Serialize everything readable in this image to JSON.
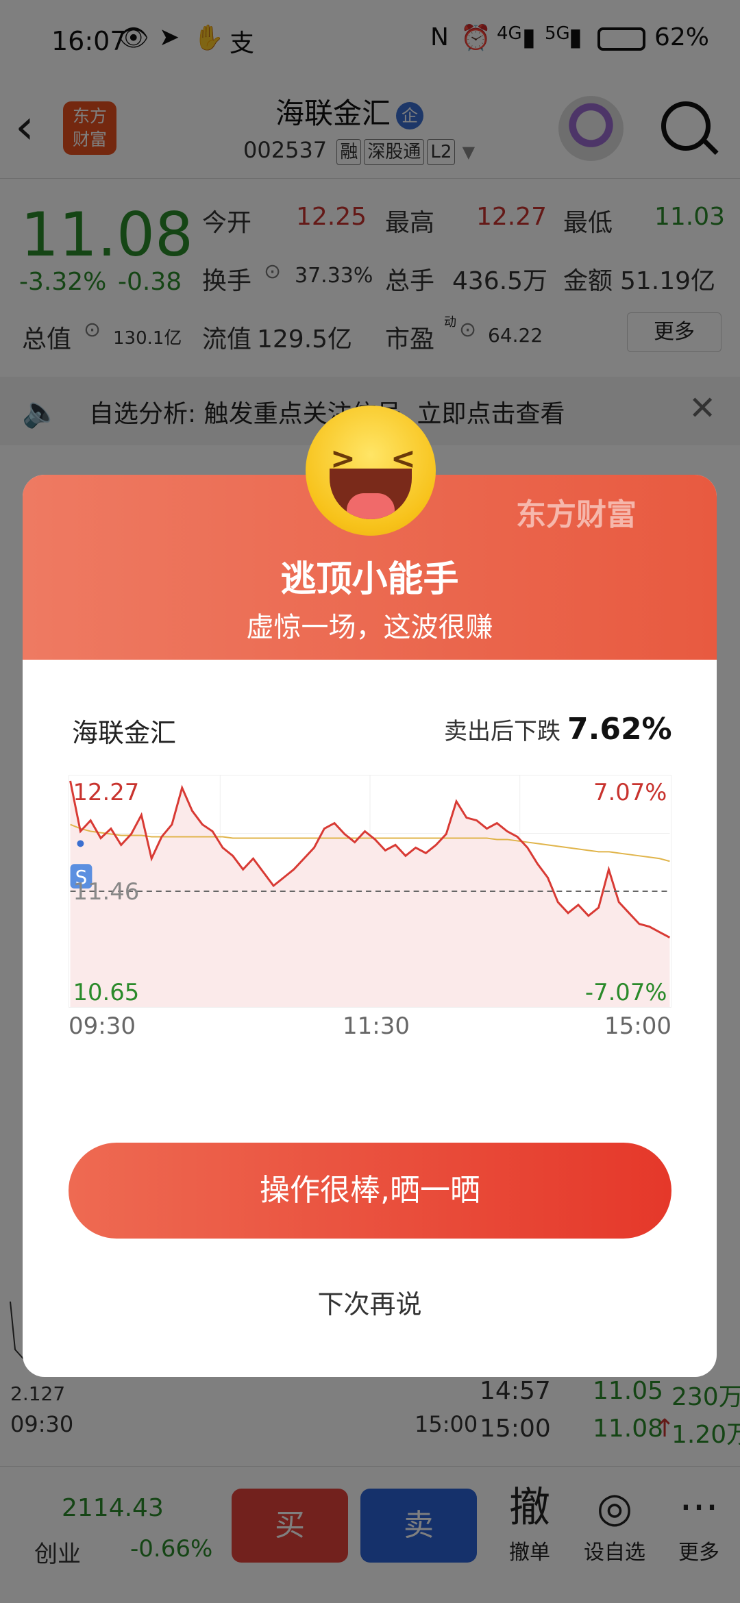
{
  "status_bar": {
    "time": "16:07",
    "left_icons": [
      "eye-icon",
      "telegram-icon",
      "hand-icon",
      "alipay-icon"
    ],
    "nfc": "N",
    "net1": "4G",
    "net2": "5G",
    "battery": "62%"
  },
  "header": {
    "back": "‹",
    "logo_line1": "东方",
    "logo_line2": "财富",
    "stock_name": "海联金汇",
    "badge": "企",
    "code": "002537",
    "tags": [
      "融",
      "深股通",
      "L2"
    ]
  },
  "quote": {
    "price": "11.08",
    "change_pct": "-3.32%",
    "change": "-0.38",
    "open_label": "今开",
    "open": "12.25",
    "high_label": "最高",
    "high": "12.27",
    "low_label": "最低",
    "low": "11.03",
    "turnover_label": "换手",
    "turnover": "37.33%",
    "volume_label": "总手",
    "volume": "436.5万",
    "amount_label": "金额",
    "amount": "51.19亿",
    "mcap_label": "总值",
    "mcap": "130.1亿",
    "float_label": "流值",
    "float": "129.5亿",
    "pe_label": "市盈",
    "pe_sup": "动",
    "pe": "64.22",
    "more": "更多"
  },
  "notice": {
    "text": "自选分析: 触发重点关注信号, 立即点击查看"
  },
  "background_trades": [
    {
      "time": "14:57",
      "price": "11.05",
      "vol": "230万"
    },
    {
      "time": "15:00",
      "price": "11.08",
      "arrow": "↑",
      "vol": "1.20万"
    }
  ],
  "background_mini_chart": {
    "label_value": "2.127",
    "start": "09:30",
    "end": "15:00"
  },
  "bottom_bar": {
    "index_value": "2114.43",
    "index_name": "创业",
    "index_change": "-0.66%",
    "buy": "买",
    "sell": "卖",
    "tools": [
      {
        "glyph": "撤",
        "label": "撤单"
      },
      {
        "glyph": "◎",
        "label": "设自选"
      },
      {
        "glyph": "···",
        "label": "更多"
      }
    ]
  },
  "modal": {
    "brand": "东方财富",
    "title": "逃顶小能手",
    "subtitle": "虚惊一场，这波很赚",
    "stock_name": "海联金汇",
    "drop_label": "卖出后下跌",
    "drop_value": "7.62%",
    "share_button": "操作很棒,晒一晒",
    "later_button": "下次再说",
    "colors": {
      "up": "#c8332e",
      "down": "#2a8a2a",
      "line": "#d83a34",
      "avg": "#e0b44a"
    }
  },
  "chart_data": {
    "type": "line",
    "x_ticks": [
      "09:30",
      "11:30",
      "15:00"
    ],
    "ylim": [
      10.65,
      12.27
    ],
    "y_labels": {
      "top": "12.27",
      "mid": "11.46",
      "bottom": "10.65"
    },
    "pct_labels": {
      "top": "7.07%",
      "bottom": "-7.07%"
    },
    "reference_price": 11.46,
    "sell_marker": {
      "label": "S",
      "x_index": 1,
      "value": 11.81
    },
    "series": [
      {
        "values": [
          12.27,
          11.9,
          11.98,
          11.85,
          11.92,
          11.8,
          11.88,
          12.02,
          11.7,
          11.86,
          11.95,
          12.22,
          12.05,
          11.95,
          11.9,
          11.78,
          11.72,
          11.62,
          11.7,
          11.6,
          11.5,
          11.56,
          11.62,
          11.7,
          11.78,
          11.92,
          11.96,
          11.88,
          11.82,
          11.9,
          11.84,
          11.76,
          11.8,
          11.72,
          11.78,
          11.74,
          11.8,
          11.88,
          12.12,
          12.0,
          11.98,
          11.92,
          11.96,
          11.9,
          11.86,
          11.78,
          11.66,
          11.56,
          11.38,
          11.3,
          11.36,
          11.28,
          11.34,
          11.62,
          11.38,
          11.3,
          11.22,
          11.2,
          11.16,
          11.12
        ]
      },
      {
        "values": [
          11.95,
          11.92,
          11.9,
          11.89,
          11.88,
          11.87,
          11.87,
          11.87,
          11.86,
          11.86,
          11.86,
          11.86,
          11.86,
          11.86,
          11.86,
          11.86,
          11.85,
          11.85,
          11.85,
          11.85,
          11.85,
          11.85,
          11.85,
          11.85,
          11.85,
          11.85,
          11.85,
          11.85,
          11.85,
          11.85,
          11.85,
          11.85,
          11.85,
          11.85,
          11.85,
          11.85,
          11.85,
          11.85,
          11.85,
          11.85,
          11.85,
          11.85,
          11.84,
          11.84,
          11.83,
          11.82,
          11.81,
          11.8,
          11.79,
          11.78,
          11.77,
          11.76,
          11.75,
          11.75,
          11.74,
          11.73,
          11.72,
          11.71,
          11.7,
          11.68
        ]
      }
    ]
  }
}
